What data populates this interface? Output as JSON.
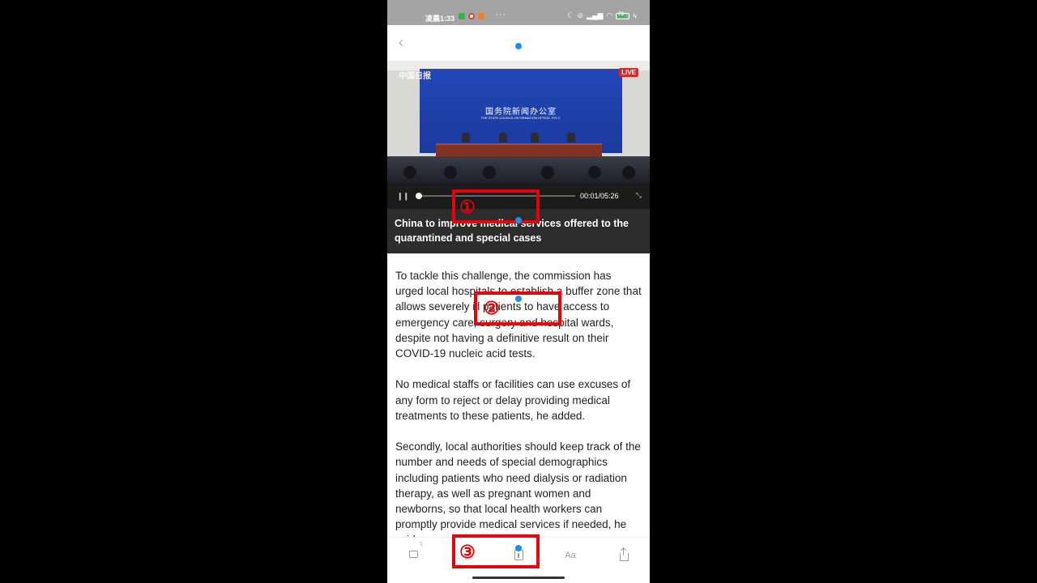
{
  "status_bar": {
    "time": "凌晨1:33",
    "more_indicator": "···",
    "battery_level": "73",
    "icons": [
      "moon-icon",
      "mute-icon",
      "signal-icon",
      "wifi-icon",
      "battery-icon",
      "charging-icon"
    ]
  },
  "header": {
    "back_icon": "back-arrow-icon"
  },
  "video": {
    "watermark": "中国日报",
    "live_badge": "LIVE",
    "backdrop_title": "国务院新闻办公室",
    "backdrop_subtitle": "THE STATE COUNCIL INFORMATION OFFICE, P.R.C.",
    "progress_fraction": 0.01,
    "timecode": "00:01/05:26",
    "pause_icon": "pause-icon",
    "fullscreen_icon": "fullscreen-icon",
    "caption": "China to improve medical services offered to the quarantined and special cases"
  },
  "article": {
    "paragraphs": [
      "To tackle this challenge, the commission has urged local hospitals to establish a buffer zone that allows severely ill patients to have access to emergency care, surgery and hospital wards, despite not having a definitive result on their COVID-19 nucleic acid tests.",
      "No medical staffs or facilities can use excuses of any form to reject or delay providing medical treatments to these patients, he added.",
      "Secondly, local authorities should keep track of the number and needs of special demographics including patients who need dialysis or radiation therapy, as well as pregnant women and newborns, so that local health workers can promptly provide medical services if needed, he said."
    ]
  },
  "bottom_bar": {
    "comment_count": "1",
    "font_label": "Aa",
    "icons": [
      "comment-icon",
      "favorite-icon",
      "bookmark-icon",
      "font-size-icon",
      "share-icon"
    ]
  },
  "annotations": {
    "labels": [
      "①",
      "②",
      "③"
    ],
    "colors": {
      "highlight": "#e8000b",
      "tap_dot": "#1a8ef2"
    }
  }
}
